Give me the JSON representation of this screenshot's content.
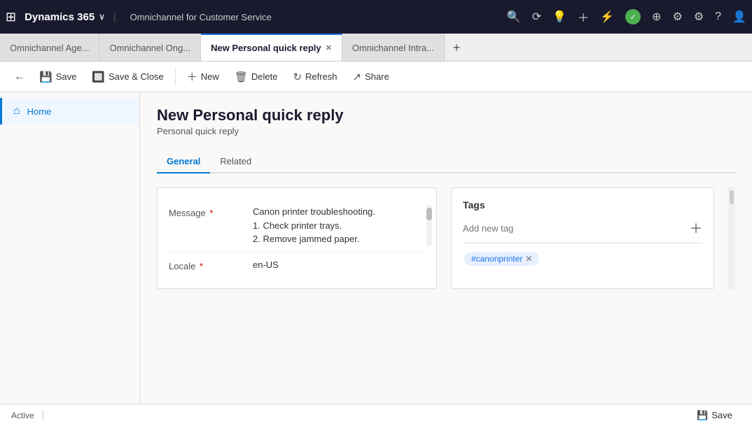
{
  "app": {
    "grid_icon": "⊞",
    "brand": "Dynamics 365",
    "brand_chevron": "∨",
    "app_name": "Omnichannel for Customer Service"
  },
  "nav_icons": [
    "🔍",
    "🔄",
    "💡",
    "+",
    "⊼",
    "●",
    "⊕",
    "⚙",
    "⚙",
    "?",
    "👤"
  ],
  "tabs": [
    {
      "label": "Omnichannel Age...",
      "active": false
    },
    {
      "label": "Omnichannel Ong...",
      "active": false
    },
    {
      "label": "New Personal quick reply",
      "active": true
    },
    {
      "label": "Omnichannel Intra...",
      "active": false
    }
  ],
  "toolbar": {
    "back_arrow": "←",
    "save_label": "Save",
    "save_close_label": "Save & Close",
    "new_label": "New",
    "delete_label": "Delete",
    "refresh_label": "Refresh",
    "share_label": "Share"
  },
  "sidebar": {
    "items": [
      {
        "label": "Home",
        "icon": "⌂",
        "active": true
      }
    ]
  },
  "page": {
    "title": "New Personal quick reply",
    "subtitle": "Personal quick reply",
    "tabs": [
      {
        "label": "General",
        "active": true
      },
      {
        "label": "Related",
        "active": false
      }
    ],
    "form": {
      "message_label": "Message",
      "message_value": "Canon printer troubleshooting.\n1. Check printer trays.\n2. Remove jammed paper.",
      "locale_label": "Locale",
      "locale_value": "en-US"
    },
    "tags": {
      "title": "Tags",
      "add_placeholder": "Add new tag",
      "items": [
        "#canonprinter"
      ]
    }
  },
  "status_bar": {
    "status": "Active",
    "save_label": "Save",
    "save_icon": "💾"
  }
}
